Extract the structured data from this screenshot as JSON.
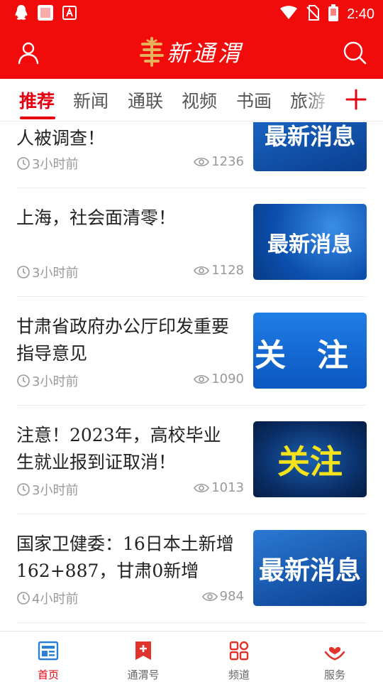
{
  "status_bar": {
    "time": "2:40"
  },
  "header": {
    "logo_text": "新通渭"
  },
  "tabs": [
    {
      "label": "推荐",
      "active": true
    },
    {
      "label": "新闻"
    },
    {
      "label": "通联"
    },
    {
      "label": "视频"
    },
    {
      "label": "书画"
    },
    {
      "label": "旅游"
    }
  ],
  "news": [
    {
      "title": "人被调查！",
      "time": "3小时前",
      "views": "1236",
      "thumb_text": "最新消息"
    },
    {
      "title": "上海，社会面清零！",
      "time": "3小时前",
      "views": "1128",
      "thumb_text": "最新消息"
    },
    {
      "title": "甘肃省政府办公厅印发重要指导意见",
      "time": "3小时前",
      "views": "1090",
      "thumb_text": "关　注"
    },
    {
      "title": "注意！2023年，高校毕业生就业报到证取消！",
      "time": "3小时前",
      "views": "1013",
      "thumb_text": "关注"
    },
    {
      "title": "国家卫健委：16日本土新增162+887，甘肃0新增",
      "time": "4小时前",
      "views": "984",
      "thumb_text": "最新消息"
    }
  ],
  "bottom_nav": [
    {
      "label": "首页",
      "active": true
    },
    {
      "label": "通渭号"
    },
    {
      "label": "频道"
    },
    {
      "label": "服务"
    }
  ],
  "colors": {
    "brand_red": "#f20b0b",
    "accent_red": "#e60012",
    "muted_gray": "#999999"
  }
}
